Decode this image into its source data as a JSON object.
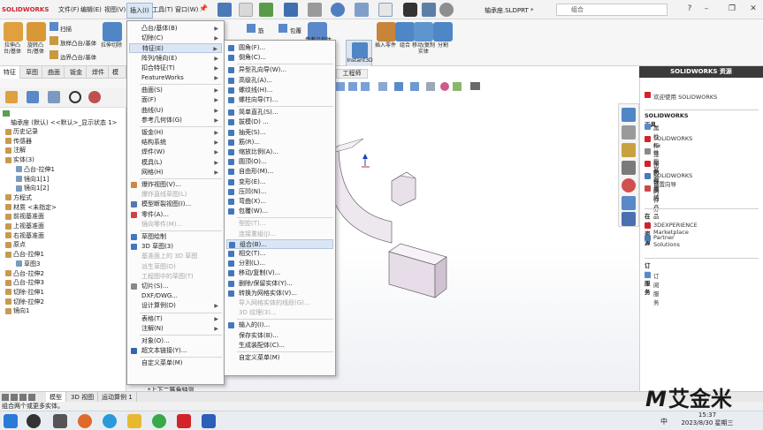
{
  "app": {
    "logo": "SOLIDWORKS",
    "document_title": "轴承座.SLDPRT *",
    "search_placeholder": "组合",
    "menubar": [
      "文件(F)",
      "编辑(E)",
      "视图(V)",
      "插入(I)",
      "工具(T)",
      "窗口(W)"
    ]
  },
  "ribbon": {
    "left_buttons": [
      "拉伸凸台/基体",
      "旋转凸台/基体",
      "扫描",
      "放样凸台/基体",
      "边界凸台/基体",
      "拉伸切除"
    ],
    "right_buttons": [
      "筋",
      "包覆",
      "曲线",
      "参考几何体",
      "Instant3D",
      "插入零件",
      "组合",
      "移动/复制实体",
      "分割"
    ]
  },
  "cm_tabs": [
    "特征",
    "草图",
    "曲面",
    "钣金",
    "焊件",
    "模具"
  ],
  "tree": {
    "root": "轴承座 (默认) <<默认>_显示状态 1>",
    "items": [
      {
        "label": "历史记录",
        "indent": 0
      },
      {
        "label": "传感器",
        "indent": 0
      },
      {
        "label": "注解",
        "indent": 0
      },
      {
        "label": "实体(3)",
        "indent": 0
      },
      {
        "label": "凸台-拉伸1",
        "indent": 2
      },
      {
        "label": "镜向1[1]",
        "indent": 2
      },
      {
        "label": "镜向1[2]",
        "indent": 2
      },
      {
        "label": "方程式",
        "indent": 0
      },
      {
        "label": "材质 <未指定>",
        "indent": 0
      },
      {
        "label": "前视基准面",
        "indent": 0
      },
      {
        "label": "上视基准面",
        "indent": 0
      },
      {
        "label": "右视基准面",
        "indent": 0
      },
      {
        "label": "原点",
        "indent": 0
      },
      {
        "label": "凸台-拉伸1",
        "indent": 0
      },
      {
        "label": "草图3",
        "indent": 2
      },
      {
        "label": "凸台-拉伸2",
        "indent": 0
      },
      {
        "label": "凸台-拉伸3",
        "indent": 0
      },
      {
        "label": "切除-拉伸1",
        "indent": 0
      },
      {
        "label": "切除-拉伸2",
        "indent": 0
      },
      {
        "label": "镜向1",
        "indent": 0
      }
    ]
  },
  "insert_menu": [
    {
      "label": "凸台/基体(B)",
      "sub": true
    },
    {
      "label": "切除(C)",
      "sub": true
    },
    {
      "label": "特征(E)",
      "sub": true,
      "hl": true
    },
    {
      "label": "阵列/镜向(E)",
      "sub": true
    },
    {
      "label": "扣合特征(T)",
      "sub": true
    },
    {
      "label": "FeatureWorks",
      "sub": true
    },
    {
      "sep": true
    },
    {
      "label": "曲面(S)",
      "sub": true
    },
    {
      "label": "面(F)",
      "sub": true
    },
    {
      "label": "曲线(U)",
      "sub": true
    },
    {
      "label": "参考几何体(G)",
      "sub": true
    },
    {
      "sep": true
    },
    {
      "label": "钣金(H)",
      "sub": true
    },
    {
      "label": "结构系统",
      "sub": true
    },
    {
      "label": "焊件(W)",
      "sub": true
    },
    {
      "label": "模具(L)",
      "sub": true
    },
    {
      "label": "网格(H)",
      "sub": true
    },
    {
      "sep": true
    },
    {
      "label": "爆炸视图(V)...",
      "icon": "#c84"
    },
    {
      "label": "爆炸直线草图(L)",
      "dis": true
    },
    {
      "label": "模型断裂视图(I)...",
      "icon": "#57a"
    },
    {
      "label": "零件(A)...",
      "icon": "#c44"
    },
    {
      "label": "镜向零件(M)...",
      "dis": true
    },
    {
      "sep": true
    },
    {
      "label": "草图绘制",
      "icon": "#47b"
    },
    {
      "label": "3D 草图(3)",
      "icon": "#47b"
    },
    {
      "label": "基准面上的 3D 草图",
      "dis": true
    },
    {
      "label": "派生草图(D)",
      "dis": true
    },
    {
      "label": "工程图中的草图(T)",
      "dis": true
    },
    {
      "label": "切片(S)...",
      "icon": "#888"
    },
    {
      "label": "DXF/DWG..."
    },
    {
      "label": "设计算例(D)",
      "sub": true
    },
    {
      "sep": true
    },
    {
      "label": "表格(T)",
      "sub": true
    },
    {
      "label": "注解(N)",
      "sub": true
    },
    {
      "sep": true
    },
    {
      "label": "对象(O)..."
    },
    {
      "label": "超文本链接(Y)...",
      "icon": "#36a"
    },
    {
      "sep": true
    },
    {
      "label": "自定义菜单(M)"
    }
  ],
  "features_submenu": [
    {
      "label": "圆角(F)...",
      "icon": "#47b"
    },
    {
      "label": "倒角(C)...",
      "icon": "#47b"
    },
    {
      "sep": true
    },
    {
      "label": "异型孔向导(W)...",
      "icon": "#47b"
    },
    {
      "label": "高级孔(A)...",
      "icon": "#47b"
    },
    {
      "label": "螺纹线(H)...",
      "icon": "#47b"
    },
    {
      "label": "螺柱向导(T)...",
      "icon": "#47b"
    },
    {
      "sep": true
    },
    {
      "label": "简单直孔(S)...",
      "icon": "#47b"
    },
    {
      "label": "拔模(D) ...",
      "icon": "#47b"
    },
    {
      "label": "抽壳(S)...",
      "icon": "#47b"
    },
    {
      "label": "筋(R)...",
      "icon": "#47b"
    },
    {
      "label": "缩放比例(A)...",
      "icon": "#47b"
    },
    {
      "label": "圆顶(O)...",
      "icon": "#47b"
    },
    {
      "label": "自由形(M)...",
      "icon": "#47b"
    },
    {
      "label": "变形(E)...",
      "icon": "#47b"
    },
    {
      "label": "压凹(N)...",
      "icon": "#47b"
    },
    {
      "label": "弯曲(X)...",
      "icon": "#47b"
    },
    {
      "label": "包覆(W)...",
      "icon": "#47b"
    },
    {
      "sep": true
    },
    {
      "label": "型腔(T)...",
      "dis": true
    },
    {
      "label": "连接重组(J)...",
      "dis": true
    },
    {
      "label": "组合(B)...",
      "icon": "#47b",
      "hl": true
    },
    {
      "label": "相交(T)...",
      "icon": "#47b"
    },
    {
      "label": "分割(L)...",
      "icon": "#47b"
    },
    {
      "label": "移动/复制(V)...",
      "icon": "#47b"
    },
    {
      "label": "删除/保留实体(Y)...",
      "icon": "#47b"
    },
    {
      "label": "转换为网格实体(V)...",
      "icon": "#47b"
    },
    {
      "label": "导入网格实体的线段(G)...",
      "dis": true
    },
    {
      "label": "3D 纹理(3)...",
      "dis": true
    },
    {
      "sep": true
    },
    {
      "label": "输入的(I)...",
      "icon": "#47b"
    },
    {
      "label": "保存实体(B)..."
    },
    {
      "label": "生成装配体(C)..."
    },
    {
      "sep": true
    },
    {
      "label": "自定义菜单(M)"
    }
  ],
  "right_pane": {
    "title": "SOLIDWORKS 资源",
    "welcome": "欢迎使用 SOLIDWORKS",
    "sections": [
      {
        "title": "SOLIDWORKS 工具",
        "items": [
          "属性标签编制程序",
          "SOLIDWORKS Rx",
          "性能基准测试",
          "比较我的评分",
          "SOLIDWORKS 设置向导",
          "我的产品"
        ]
      },
      {
        "title": "在线资源",
        "items": [
          "3DEXPERIENCE Marketplace",
          "Partner Solutions"
        ]
      },
      {
        "title": "订阅服务",
        "items": [
          "订阅服务"
        ]
      }
    ]
  },
  "graphics": {
    "view_label": "*上下二等角轴测",
    "drawing_tab": "工程师"
  },
  "bottom_tabs": [
    "模型",
    "3D 视图",
    "运动算例 1"
  ],
  "status_text": "组合两个或更多实体。",
  "clock": {
    "time": "15:37",
    "date": "2023/8/30 星期三"
  },
  "brand": "艾金米",
  "brand_mark": "M",
  "ime": "中"
}
